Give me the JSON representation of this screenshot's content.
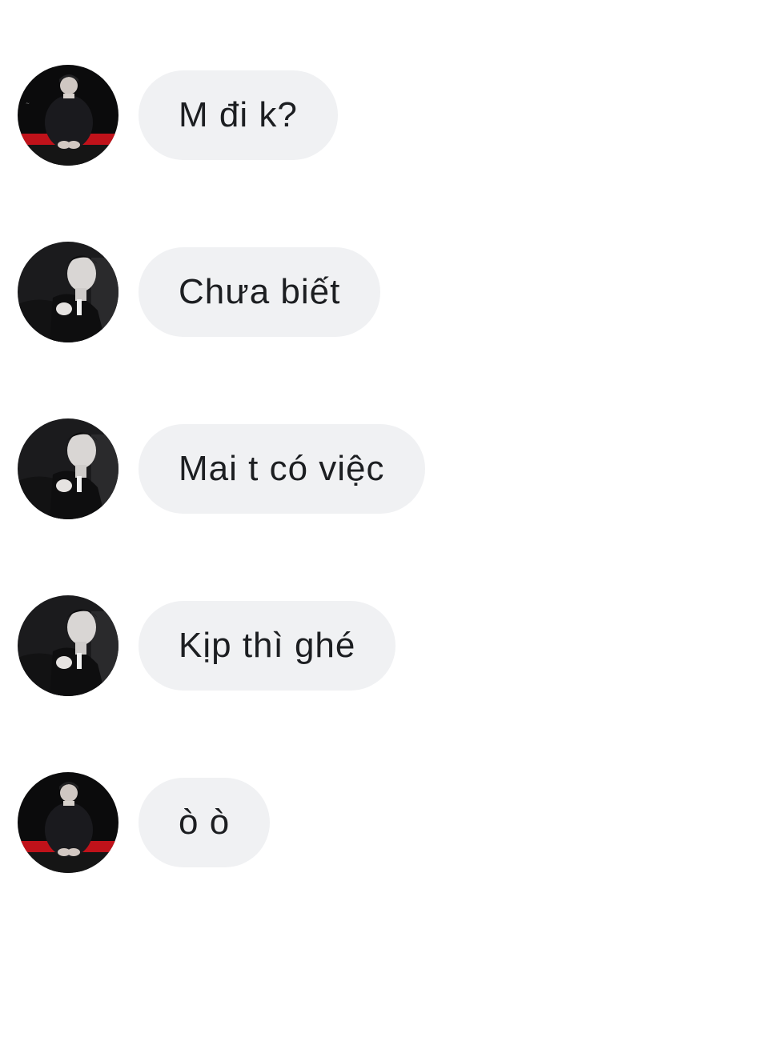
{
  "conversation": {
    "messages": [
      {
        "text": "M đi k?",
        "avatar": "person-seated-red-stage-avatar"
      },
      {
        "text": "Chưa biết",
        "avatar": "person-monochrome-portrait-avatar"
      },
      {
        "text": "Mai t có việc",
        "avatar": "person-monochrome-portrait-avatar"
      },
      {
        "text": "Kịp thì ghé",
        "avatar": "person-monochrome-portrait-avatar"
      },
      {
        "text": "ò ò",
        "avatar": "person-seated-red-stage-avatar"
      }
    ]
  },
  "colors": {
    "bubble_background": "#f0f1f3",
    "message_text": "#1c1e21",
    "page_background": "#ffffff",
    "stage_red": "#c0121a"
  }
}
